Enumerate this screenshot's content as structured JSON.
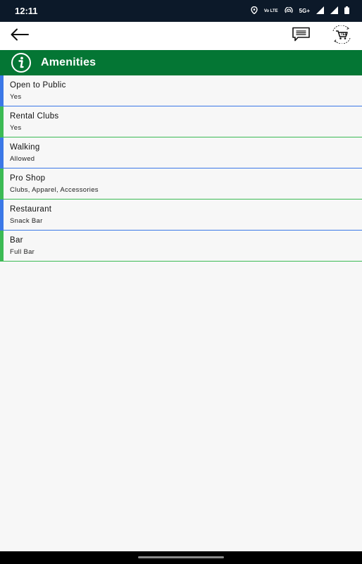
{
  "status_bar": {
    "time": "12:11",
    "volte_label": "Vo LTE",
    "network_label": "5G+",
    "icons": [
      "location-icon",
      "volte-icon",
      "hotspot-icon",
      "signal-5g-icon",
      "signal-icon",
      "battery-icon"
    ]
  },
  "app_bar": {
    "icons": [
      "back-arrow-icon",
      "chat-icon",
      "cart-icon"
    ]
  },
  "section": {
    "title": "Amenities",
    "icon": "info-icon",
    "color": "#047634"
  },
  "amenities": [
    {
      "label": "Open to Public",
      "value": "Yes",
      "accent": "#3b78e7"
    },
    {
      "label": "Rental Clubs",
      "value": "Yes",
      "accent": "#3cba54"
    },
    {
      "label": "Walking",
      "value": "Allowed",
      "accent": "#3b78e7"
    },
    {
      "label": "Pro Shop",
      "value": "Clubs, Apparel, Accessories",
      "accent": "#3cba54"
    },
    {
      "label": "Restaurant",
      "value": "Snack Bar",
      "accent": "#3b78e7"
    },
    {
      "label": "Bar",
      "value": "Full Bar",
      "accent": "#3cba54"
    }
  ]
}
